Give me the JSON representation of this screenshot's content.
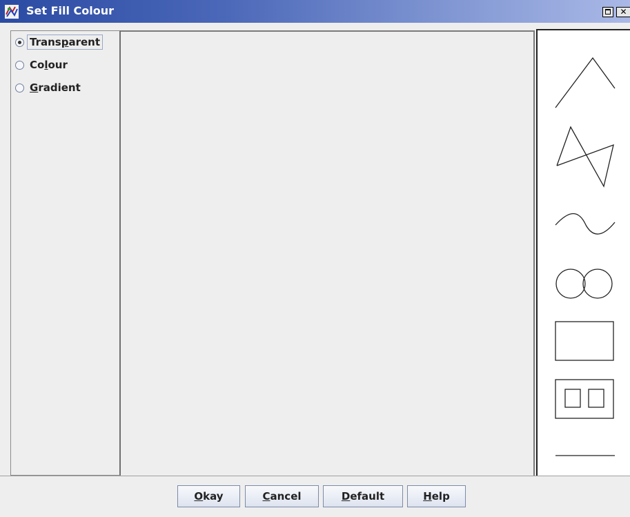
{
  "window": {
    "title": "Set Fill Colour"
  },
  "options": [
    {
      "label_pre": "Trans",
      "label_key": "p",
      "label_post": "arent",
      "selected": true
    },
    {
      "label_pre": "Co",
      "label_key": "l",
      "label_post": "our",
      "selected": false
    },
    {
      "label_pre": "",
      "label_key": "G",
      "label_post": "radient",
      "selected": false
    }
  ],
  "shapes": [
    "angle-icon",
    "zigzag-icon",
    "wave-icon",
    "double-circle-icon",
    "rectangle-icon",
    "double-square-icon",
    "line-icon"
  ],
  "buttons": {
    "okay": {
      "key": "O",
      "rest": "kay"
    },
    "cancel": {
      "key": "C",
      "rest": "ancel"
    },
    "default": {
      "key": "D",
      "rest": "efault"
    },
    "help": {
      "key": "H",
      "rest": "elp"
    }
  },
  "colors": {
    "titlebar_start": "#2b4ba3",
    "titlebar_end": "#a9b8e6",
    "panel_bg": "#eeeeee"
  }
}
